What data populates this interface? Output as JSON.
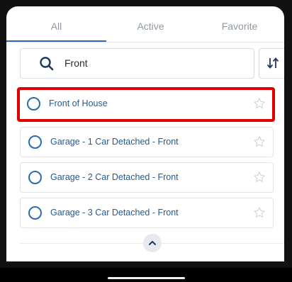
{
  "tabs": [
    {
      "label": "All",
      "active": true
    },
    {
      "label": "Active",
      "active": false
    },
    {
      "label": "Favorite",
      "active": false
    }
  ],
  "search": {
    "value": "Front",
    "icon": "search-icon"
  },
  "sort": {
    "icon": "sort-icon"
  },
  "items": [
    {
      "label": "Front of House",
      "selected": false,
      "highlighted": true,
      "favorite": false
    },
    {
      "label": "Garage - 1 Car Detached - Front",
      "selected": false,
      "favorite": false
    },
    {
      "label": "Garage - 2 Car Detached - Front",
      "selected": false,
      "favorite": false
    },
    {
      "label": "Garage - 3 Car Detached - Front",
      "selected": false,
      "favorite": false
    }
  ],
  "collapse": {
    "icon": "chevron-up-icon"
  },
  "colors": {
    "accent": "#2d6bae",
    "highlight": "#e00000",
    "item_text": "#1f5a96"
  }
}
